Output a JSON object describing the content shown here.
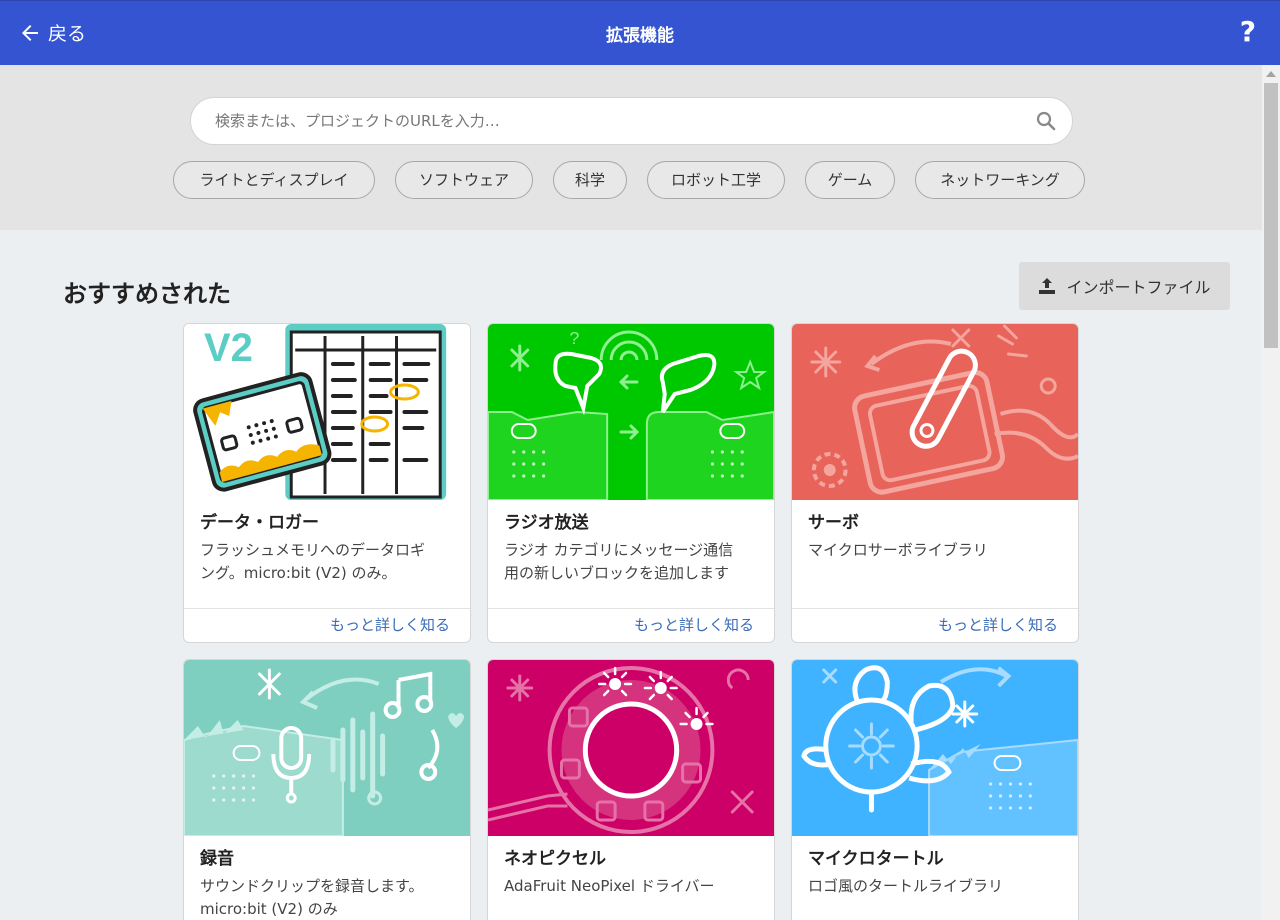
{
  "header": {
    "back_label": "戻る",
    "title": "拡張機能",
    "help_label": "?"
  },
  "search": {
    "placeholder": "検索または、プロジェクトのURLを入力…"
  },
  "categories": [
    "ライトとディスプレイ",
    "ソフトウェア",
    "科学",
    "ロボット工学",
    "ゲーム",
    "ネットワーキング"
  ],
  "section": {
    "title": "おすすめされた",
    "import_label": "インポートファイル"
  },
  "cards": [
    {
      "name": "データ・ロガー",
      "desc": [
        "フラッシュメモリへのデータロギ",
        "ング。micro:bit (V2) のみ。"
      ],
      "more": "もっと詳しく知る",
      "color": "#ffffff",
      "badge": "V2"
    },
    {
      "name": "ラジオ放送",
      "desc": [
        "ラジオ カテゴリにメッセージ通信",
        "用の新しいブロックを追加します"
      ],
      "more": "もっと詳しく知る",
      "color": "#00c800"
    },
    {
      "name": "サーボ",
      "desc": [
        "マイクロサーボライブラリ"
      ],
      "more": "もっと詳しく知る",
      "color": "#e8645a"
    },
    {
      "name": "録音",
      "desc": [
        "サウンドクリップを録音します。",
        "micro:bit (V2) のみ"
      ],
      "more": "",
      "color": "#7ecfc0"
    },
    {
      "name": "ネオピクセル",
      "desc": [
        "AdaFruit NeoPixel ドライバー"
      ],
      "more": "",
      "color": "#cc0066"
    },
    {
      "name": "マイクロタートル",
      "desc": [
        "ロゴ風のタートルライブラリ"
      ],
      "more": "",
      "color": "#3fb3ff"
    }
  ]
}
